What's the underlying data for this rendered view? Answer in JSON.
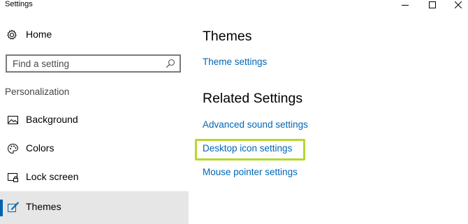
{
  "window": {
    "title": "Settings",
    "controls": {
      "minimize": "minimize-icon",
      "maximize": "maximize-icon",
      "close": "close-icon"
    }
  },
  "sidebar": {
    "home": {
      "label": "Home",
      "icon": "gear-icon"
    },
    "search": {
      "placeholder": "Find a setting",
      "icon": "search-icon"
    },
    "section_label": "Personalization",
    "items": [
      {
        "label": "Background",
        "icon": "picture-icon",
        "selected": false
      },
      {
        "label": "Colors",
        "icon": "palette-icon",
        "selected": false
      },
      {
        "label": "Lock screen",
        "icon": "lock-screen-icon",
        "selected": false
      },
      {
        "label": "Themes",
        "icon": "brush-icon",
        "selected": true
      }
    ]
  },
  "main": {
    "themes_heading": "Themes",
    "theme_settings_link": "Theme settings",
    "related_heading": "Related Settings",
    "related_links": [
      "Advanced sound settings",
      "Desktop icon settings",
      "Mouse pointer settings"
    ]
  },
  "colors": {
    "accent": "#0063b1",
    "link": "#0067b8",
    "highlight": "#b5d82c",
    "selected_bg": "#e6e6e6"
  }
}
